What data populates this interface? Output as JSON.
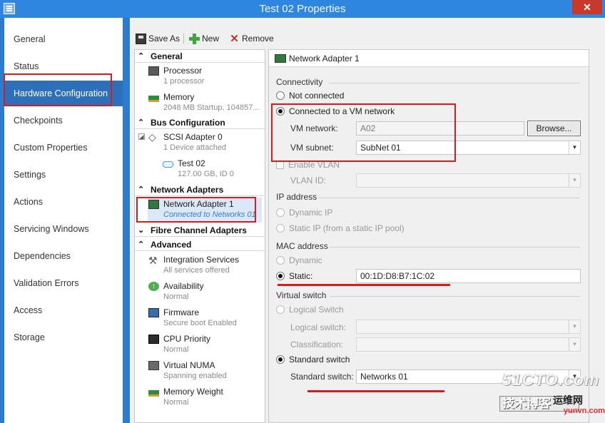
{
  "window": {
    "title": "Test 02 Properties",
    "close_label": "✕"
  },
  "nav": {
    "items": [
      "General",
      "Status",
      "Hardware Configuration",
      "Checkpoints",
      "Custom Properties",
      "Settings",
      "Actions",
      "Servicing Windows",
      "Dependencies",
      "Validation Errors",
      "Access",
      "Storage"
    ],
    "active": "Hardware Configuration"
  },
  "toolbar": {
    "save_as": "Save As",
    "new": "New",
    "remove": "Remove"
  },
  "tree": {
    "general_header": "General",
    "processor": {
      "name": "Processor",
      "sub": "1 processor"
    },
    "memory": {
      "name": "Memory",
      "sub": "2048 MB Startup, 104857..."
    },
    "bus_header": "Bus Configuration",
    "scsi": {
      "name": "SCSI Adapter 0",
      "sub": "1 Device attached"
    },
    "disk": {
      "name": "Test 02",
      "sub": "127.00 GB, ID 0"
    },
    "network_header": "Network Adapters",
    "nic": {
      "name": "Network Adapter 1",
      "sub": "Connected to Networks 01"
    },
    "fibre_header": "Fibre Channel Adapters",
    "advanced_header": "Advanced",
    "integration": {
      "name": "Integration Services",
      "sub": "All services offered"
    },
    "availability": {
      "name": "Availability",
      "sub": "Normal"
    },
    "firmware": {
      "name": "Firmware",
      "sub": "Secure boot Enabled"
    },
    "cpu_priority": {
      "name": "CPU Priority",
      "sub": "Normal"
    },
    "numa": {
      "name": "Virtual NUMA",
      "sub": "Spanning enabled"
    },
    "memory_weight": {
      "name": "Memory Weight",
      "sub": "Normal"
    }
  },
  "details": {
    "title": "Network Adapter 1",
    "connectivity": {
      "label": "Connectivity",
      "not_connected": "Not connected",
      "connected_vm": "Connected to a VM network",
      "vm_network_label": "VM network:",
      "vm_network_value": "A02",
      "browse": "Browse...",
      "vm_subnet_label": "VM subnet:",
      "vm_subnet_value": "SubNet 01",
      "enable_vlan": "Enable VLAN",
      "vlan_id_label": "VLAN ID:"
    },
    "ip": {
      "label": "IP address",
      "dynamic": "Dynamic IP",
      "static": "Static IP (from a static IP pool)"
    },
    "mac": {
      "label": "MAC address",
      "dynamic": "Dynamic",
      "static": "Static:",
      "value": "00:1D:D8:B7:1C:02"
    },
    "vswitch": {
      "label": "Virtual switch",
      "logical": "Logical Switch",
      "logical_switch_label": "Logical switch:",
      "classification_label": "Classification:",
      "standard": "Standard switch",
      "standard_switch_label": "Standard switch:",
      "standard_switch_value": "Networks 01"
    }
  },
  "watermark": {
    "main": "51CTO.com",
    "sub": "技术博客",
    "blog": "运维网",
    "url": "yunvn.com"
  },
  "colors": {
    "accent": "#2e6fba",
    "annotation": "#d41e1e",
    "titlebar": "#2e86de"
  }
}
